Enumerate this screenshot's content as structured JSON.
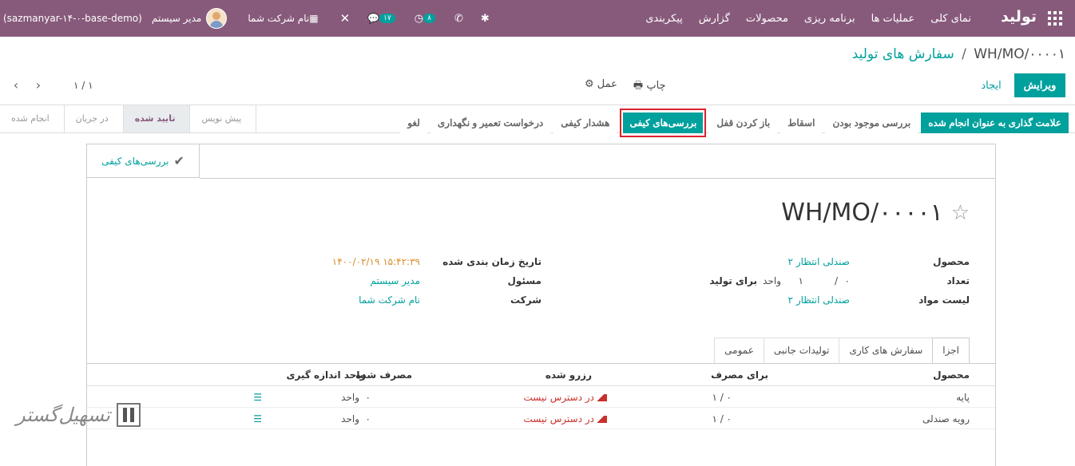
{
  "navbar": {
    "brand": "تولید",
    "menu": [
      "نمای کلی",
      "عملیات ها",
      "برنامه ریزی",
      "محصولات",
      "گزارش",
      "پیکربندی"
    ],
    "db_name": "(sazmanyar-۱۴-۰-base-demo)",
    "user_name": "مدیر سیستم",
    "company": "نام شرکت شما",
    "messages_badge": "۱۷",
    "activities_badge": "۸",
    "accent_color": "#875a7b"
  },
  "control": {
    "breadcrumb_parent": "سفارش های تولید",
    "breadcrumb_sep": "/",
    "breadcrumb_current": "WH/MO/۰۰۰۰۱",
    "edit": "ویرایش",
    "create": "ایجاد",
    "print": "چاپ",
    "action": "عمل",
    "pager": "۱ / ۱"
  },
  "statusbar": {
    "buttons": [
      "علامت گذاری به عنوان انجام شده",
      "بررسی موجود بودن",
      "اسقاط",
      "باز کردن قفل",
      "بررسی‌های کیفی",
      "هشدار کیفی",
      "درخواست تعمیر و نگهداری",
      "لغو"
    ],
    "stages": [
      "پیش نویس",
      "تایید شده",
      "در جریان",
      "انجام شده"
    ],
    "active_stage": "تایید شده"
  },
  "sheet": {
    "smart_button": "بررسی‌های کیفی",
    "title": "WH/MO/۰۰۰۰۱",
    "fields": {
      "product_label": "محصول",
      "product_value": "صندلی انتظار ۲",
      "qty_label": "تعداد",
      "qty_done": "۰",
      "qty_sep": "/",
      "qty_total": "۱",
      "qty_uom": "واحد",
      "qty_to_produce": "برای تولید",
      "bom_label": "لیست مواد",
      "bom_value": "صندلی انتظار ۲",
      "date_label": "تاریخ زمان بندی شده",
      "date_value": "۱۴۰۰/۰۲/۱۹ ۱۵:۴۲:۳۹",
      "responsible_label": "مسئول",
      "responsible_value": "مدیر سیستم",
      "company_label": "شرکت",
      "company_value": "نام شرکت شما"
    },
    "tabs": [
      "اجزا",
      "سفارش های کاری",
      "تولیدات جانبی",
      "عمومی"
    ],
    "table": {
      "headers": [
        "محصول",
        "برای مصرف",
        "رزرو شده",
        "مصرف شده",
        "واحد اندازه گیری"
      ],
      "rows": [
        {
          "product": "پایه",
          "to_consume": "۱ / ۰",
          "reserved": "در دسترس نیست",
          "consumed": "۰",
          "uom": "واحد"
        },
        {
          "product": "رویه صندلی",
          "to_consume": "۱ / ۰",
          "reserved": "در دسترس نیست",
          "consumed": "۰",
          "uom": "واحد"
        }
      ]
    }
  },
  "watermark": "تسهیل‌گستر"
}
